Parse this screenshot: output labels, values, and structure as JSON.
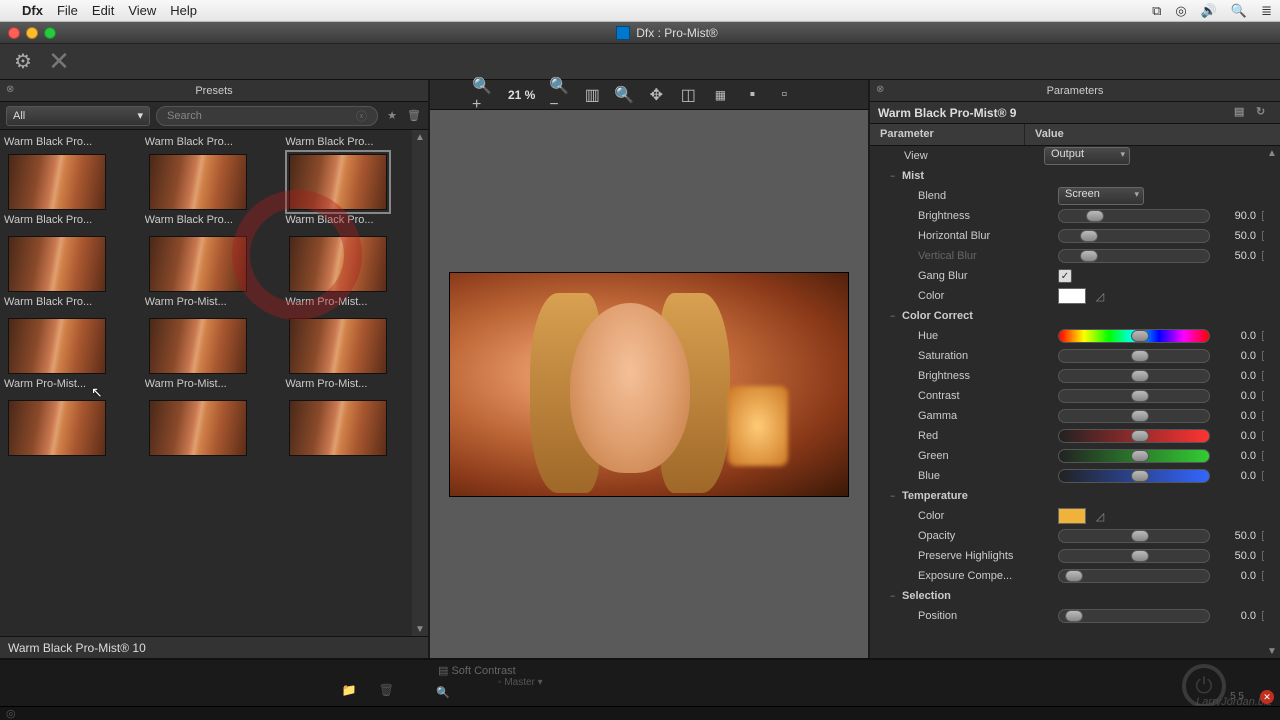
{
  "menubar": {
    "app": "Dfx",
    "items": [
      "File",
      "Edit",
      "View",
      "Help"
    ]
  },
  "window": {
    "title": "Dfx : Pro-Mist®"
  },
  "presets": {
    "header": "Presets",
    "filter": "All",
    "search_placeholder": "Search",
    "row_top": [
      "Warm Black Pro...",
      "Warm Black Pro...",
      "Warm Black Pro..."
    ],
    "items": [
      {
        "label": "Warm Black Pro..."
      },
      {
        "label": "Warm Black Pro..."
      },
      {
        "label": "Warm Black Pro...",
        "selected": true
      },
      {
        "label": "Warm Black Pro..."
      },
      {
        "label": "Warm Pro-Mist..."
      },
      {
        "label": "Warm Pro-Mist..."
      },
      {
        "label": "Warm Pro-Mist..."
      },
      {
        "label": "Warm Pro-Mist..."
      },
      {
        "label": "Warm Pro-Mist..."
      },
      {
        "label": ""
      },
      {
        "label": ""
      },
      {
        "label": ""
      }
    ],
    "status": "Warm Black Pro-Mist® 10"
  },
  "viewer": {
    "zoom": "21 %"
  },
  "params": {
    "header": "Parameters",
    "title": "Warm Black Pro-Mist® 9",
    "col1": "Parameter",
    "col2": "Value",
    "rows": [
      {
        "type": "select",
        "label": "View",
        "value": "Output",
        "indent": 1
      },
      {
        "type": "group",
        "label": "Mist",
        "indent": 0
      },
      {
        "type": "select",
        "label": "Blend",
        "value": "Screen",
        "indent": 2
      },
      {
        "type": "slider",
        "label": "Brightness",
        "value": "90.0",
        "knob": 18,
        "indent": 2
      },
      {
        "type": "slider",
        "label": "Horizontal Blur",
        "value": "50.0",
        "knob": 14,
        "indent": 2
      },
      {
        "type": "slider",
        "label": "Vertical Blur",
        "value": "50.0",
        "knob": 14,
        "indent": 2,
        "dim": true
      },
      {
        "type": "check",
        "label": "Gang Blur",
        "checked": true,
        "indent": 2
      },
      {
        "type": "swatch",
        "label": "Color",
        "color": "#ffffff",
        "indent": 2
      },
      {
        "type": "group",
        "label": "Color Correct",
        "indent": 0
      },
      {
        "type": "slider",
        "label": "Hue",
        "value": "0.0",
        "knob": 48,
        "variant": "hue",
        "indent": 2
      },
      {
        "type": "slider",
        "label": "Saturation",
        "value": "0.0",
        "knob": 48,
        "indent": 2
      },
      {
        "type": "slider",
        "label": "Brightness",
        "value": "0.0",
        "knob": 48,
        "indent": 2
      },
      {
        "type": "slider",
        "label": "Contrast",
        "value": "0.0",
        "knob": 48,
        "indent": 2
      },
      {
        "type": "slider",
        "label": "Gamma",
        "value": "0.0",
        "knob": 48,
        "indent": 2
      },
      {
        "type": "slider",
        "label": "Red",
        "value": "0.0",
        "knob": 48,
        "variant": "red",
        "indent": 2
      },
      {
        "type": "slider",
        "label": "Green",
        "value": "0.0",
        "knob": 48,
        "variant": "green",
        "indent": 2
      },
      {
        "type": "slider",
        "label": "Blue",
        "value": "0.0",
        "knob": 48,
        "variant": "blue",
        "indent": 2
      },
      {
        "type": "group",
        "label": "Temperature",
        "indent": 0
      },
      {
        "type": "swatch",
        "label": "Color",
        "color": "#f0b23a",
        "indent": 2
      },
      {
        "type": "slider",
        "label": "Opacity",
        "value": "50.0",
        "knob": 48,
        "indent": 2
      },
      {
        "type": "slider",
        "label": "Preserve Highlights",
        "value": "50.0",
        "knob": 48,
        "indent": 2
      },
      {
        "type": "slider",
        "label": "Exposure Compe...",
        "value": "0.0",
        "knob": 4,
        "indent": 2
      },
      {
        "type": "group",
        "label": "Selection",
        "indent": 0
      },
      {
        "type": "slider",
        "label": "Position",
        "value": "0.0",
        "knob": 4,
        "indent": 2
      }
    ]
  },
  "footer": {
    "soft_contrast": "Soft Contrast",
    "master": "Master",
    "db": "5  5",
    "brand": "LarryJordan.biz"
  }
}
